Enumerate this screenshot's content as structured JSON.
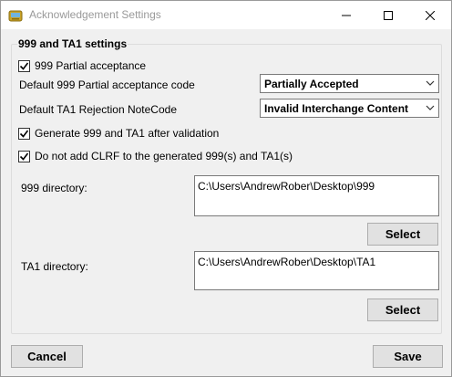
{
  "window": {
    "title": "Acknowledgement Settings"
  },
  "group": {
    "title": "999 and TA1 settings"
  },
  "partial_acceptance": {
    "label": "999 Partial acceptance",
    "checked": true
  },
  "default_999_code": {
    "label": "Default 999 Partial acceptance code",
    "value": "Partially Accepted"
  },
  "default_ta1_code": {
    "label": "Default TA1 Rejection NoteCode",
    "value": "Invalid Interchange Content"
  },
  "generate_after_validation": {
    "label": "Generate 999 and TA1 after validation",
    "checked": true
  },
  "no_clrf": {
    "label": "Do not add CLRF to the generated 999(s) and TA1(s)",
    "checked": true
  },
  "dir_999": {
    "label": "999 directory:",
    "value": "C:\\Users\\AndrewRober\\Desktop\\999",
    "select_label": "Select"
  },
  "dir_ta1": {
    "label": "TA1 directory:",
    "value": "C:\\Users\\AndrewRober\\Desktop\\TA1",
    "select_label": "Select"
  },
  "footer": {
    "cancel_label": "Cancel",
    "save_label": "Save"
  }
}
